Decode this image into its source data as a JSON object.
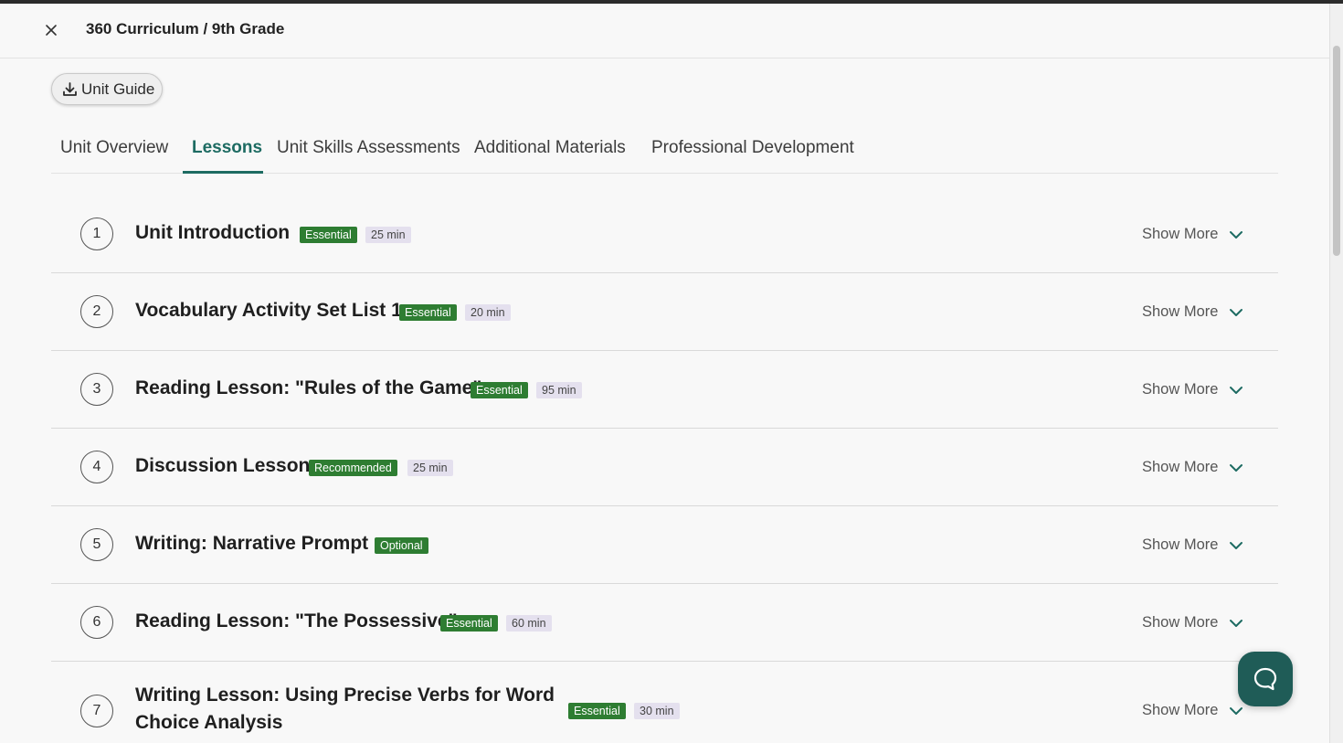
{
  "header": {
    "title": "360 Curriculum / 9th Grade"
  },
  "toolbar": {
    "unit_guide_label": "Unit Guide"
  },
  "tabs": [
    {
      "label": "Unit Overview",
      "active": false
    },
    {
      "label": "Lessons",
      "active": true
    },
    {
      "label": "Unit Skills Assessments",
      "active": false
    },
    {
      "label": "Additional Materials",
      "active": false
    },
    {
      "label": "Professional Development",
      "active": false
    }
  ],
  "lessons": [
    {
      "number": "1",
      "title": "Unit Introduction",
      "type": "Essential",
      "duration": "25 min",
      "action": "Show More"
    },
    {
      "number": "2",
      "title": "Vocabulary Activity Set List 1",
      "type": "Essential",
      "duration": "20 min",
      "action": "Show More"
    },
    {
      "number": "3",
      "title": "Reading Lesson: \"Rules of the Game\"",
      "type": "Essential",
      "duration": "95 min",
      "action": "Show More"
    },
    {
      "number": "4",
      "title": "Discussion Lesson",
      "type": "Recommended",
      "duration": "25 min",
      "action": "Show More"
    },
    {
      "number": "5",
      "title": "Writing: Narrative Prompt",
      "type": "Optional",
      "duration": "",
      "action": "Show More"
    },
    {
      "number": "6",
      "title": "Reading Lesson: \"The Possessive\"",
      "type": "Essential",
      "duration": "60 min",
      "action": "Show More"
    },
    {
      "number": "7",
      "title_line1": "Writing Lesson: Using Precise Verbs for Word",
      "title_line2": "Choice Analysis",
      "type": "Essential",
      "duration": "30 min",
      "action": "Show More"
    }
  ],
  "colors": {
    "accent": "#1d6b62",
    "badge_green": "#2e7d32",
    "badge_time": "#e4e0ee",
    "chat": "#1f5c57"
  },
  "icons": {
    "close": "close-icon",
    "download": "download-icon",
    "chevron": "chevron-down-icon",
    "chat": "chat-bubble-icon"
  }
}
